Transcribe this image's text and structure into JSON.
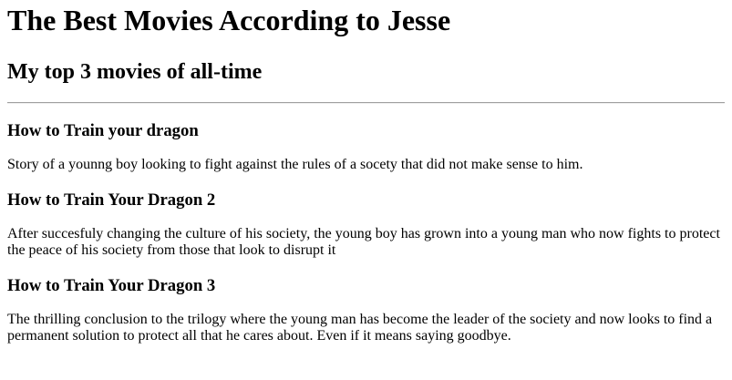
{
  "header": {
    "title": "The Best Movies According to Jesse",
    "subtitle": "My top 3 movies of all-time"
  },
  "movies": [
    {
      "title": "How to Train your dragon",
      "description": "Story of a younng boy looking to fight against the rules of a socety that did not make sense to him."
    },
    {
      "title": "How to Train Your Dragon 2",
      "description": "After succesfuly changing the culture of his society, the young boy has grown into a young man who now fights to protect the peace of his society from those that look to disrupt it"
    },
    {
      "title": "How to Train Your Dragon 3",
      "description": "The thrilling conclusion to the trilogy where the young man has become the leader of the society and now looks to find a permanent solution to protect all that he cares about. Even if it means saying goodbye."
    }
  ]
}
